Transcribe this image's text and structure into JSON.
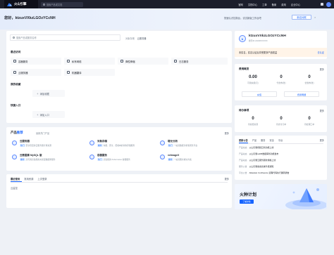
{
  "topnav": {
    "brand": "火山引擎",
    "search_placeholder": "搜索产品或文档",
    "links": [
      "官网",
      "文档中心",
      "工单",
      "备案",
      "费用",
      "企业中心"
    ]
  },
  "welcome": {
    "greeting": "您好，ktzuxVXkzLGOzYCcNH",
    "tip": "快速认识控制台，试试新版工作台吧",
    "tip_button": "新旧对照"
  },
  "main": {
    "search_placeholder": "搜索产品或服务名称",
    "recent_label": "对象存储",
    "recent_item": "云服务器",
    "recent_visits_title": "最近访问",
    "services": [
      "容器服务",
      "私有网络",
      "弹性伸缩",
      "日志服务",
      "云服务器",
      "机器翻译"
    ],
    "favorites_title": "我的收藏",
    "add_favorite": "添加收藏",
    "shortcuts_title": "快捷入口",
    "add_shortcut": "添加入口"
  },
  "products": {
    "title_prefix": "产品",
    "title_highlight": "推荐",
    "subtitle": "最新热门产品",
    "more": "更多",
    "items": [
      {
        "name": "云服务器",
        "tag": "热门",
        "desc": "安全稳定的云服务器计算资源"
      },
      {
        "name": "对象存储",
        "tag": "推荐",
        "desc": "海量、安全、低成本的对象存储服务"
      },
      {
        "name": "增长分析",
        "tag": "热门",
        "desc": "一站式数据分析和增长平台"
      },
      {
        "name": "云数据库 MySQL 版",
        "tag": "推荐",
        "desc": "高可用高性能的关系型数据库服务"
      },
      {
        "name": "容器服务",
        "tag": "热门",
        "desc": "高性能的 Kubernetes 容器服务"
      },
      {
        "name": "veImageX",
        "tag": "推荐",
        "desc": "一站式图片解决方案"
      }
    ]
  },
  "recent_usage": {
    "tabs": [
      "最近使用",
      "常用资源",
      "上次登录"
    ],
    "more": "更多",
    "item": "云监控"
  },
  "account": {
    "avatar_letter": "k",
    "name": "ktzuxVXkzLGOzYCcNH",
    "id": "账号ID 2100XXXXXX",
    "banner_text": "未实名，实名认证后享受更多产品权益",
    "banner_action": "去认证"
  },
  "fees": {
    "title": "费用概览",
    "more": "更多",
    "balance": "0.00",
    "balance_label": "可用余额(元)",
    "voucher": "0",
    "voucher_label": "代金券(张)",
    "coupon": "0",
    "coupon_label": "优惠券(张)",
    "recharge_btn": "充值",
    "detail_btn": "费用明细"
  },
  "todo": {
    "title": "待办事项",
    "more": "更多",
    "items": [
      {
        "count": "0",
        "label": "待续费资源"
      },
      {
        "count": "0",
        "label": "待支付订单"
      },
      {
        "count": "0",
        "label": "待处理工单"
      }
    ]
  },
  "announcements": {
    "tabs": [
      "更新公告",
      "产品",
      "服务",
      "安全",
      "平台"
    ],
    "more": "更多",
    "rows": [
      {
        "tag": "产品动态",
        "text": "火山引擎视频云新功能上线"
      },
      {
        "tag": "产品动态",
        "text": "火山引擎veDB数据库新功能发布"
      },
      {
        "tag": "产品动态",
        "text": "火山引擎云服务器新规格上线"
      },
      {
        "tag": "服务公告",
        "text": "火山引擎备案系统升级通知"
      },
      {
        "tag": "平台公告",
        "text": "Atlassian Confluence 远程代码执行漏洞通告"
      }
    ]
  },
  "promo": {
    "title": "火种计划",
    "button": "了解详情"
  }
}
